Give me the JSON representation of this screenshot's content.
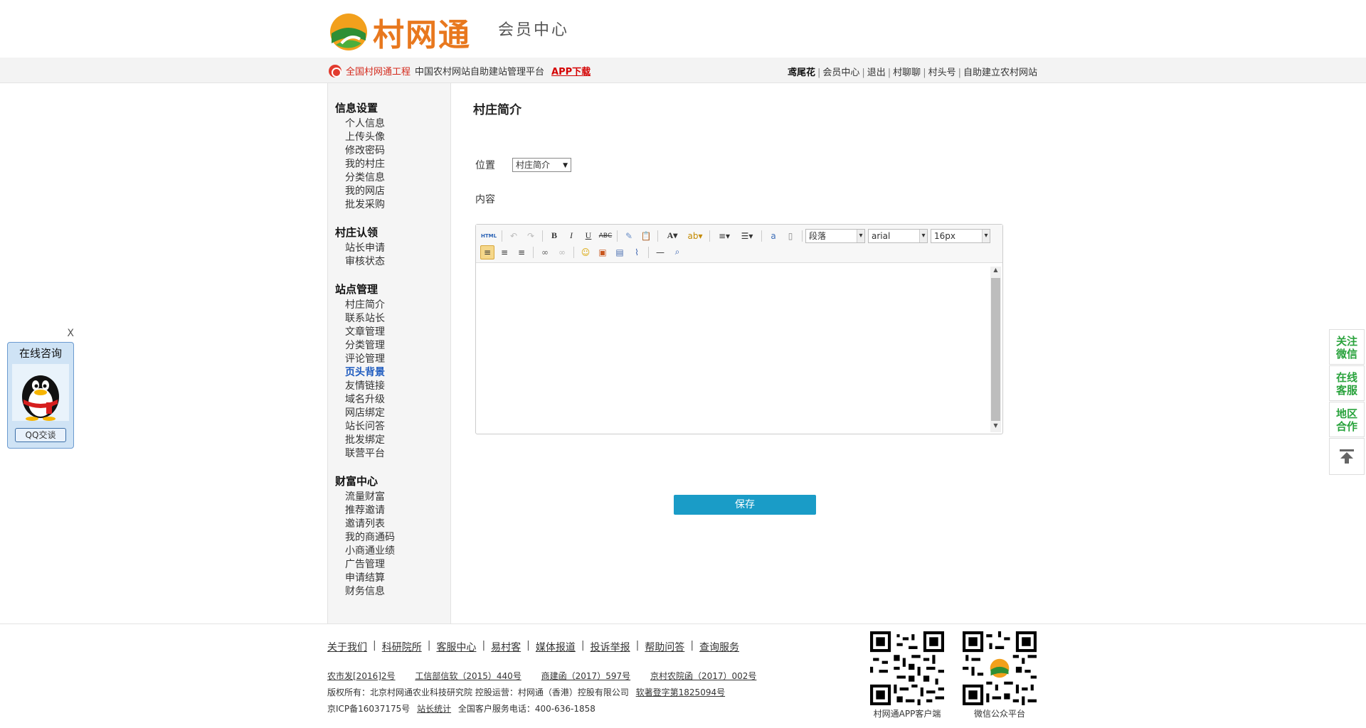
{
  "header": {
    "brand": "村网通",
    "subtitle": "会员中心"
  },
  "topbar": {
    "org_name": "全国村网通工程",
    "slogan": "中国农村网站自助建站管理平台",
    "app_download": "APP下载",
    "user": "鸢尾花",
    "links": [
      "会员中心",
      "退出",
      "村聊聊",
      "村头号",
      "自助建立农村网站"
    ]
  },
  "sidebar": {
    "groups": [
      {
        "title": "信息设置",
        "items": [
          "个人信息",
          "上传头像",
          "修改密码",
          "我的村庄",
          "分类信息",
          "我的网店",
          "批发采购"
        ]
      },
      {
        "title": "村庄认领",
        "items": [
          "站长申请",
          "审核状态"
        ]
      },
      {
        "title": "站点管理",
        "items": [
          "村庄简介",
          "联系站长",
          "文章管理",
          "分类管理",
          "评论管理",
          "页头背景",
          "友情链接",
          "域名升级",
          "网店绑定",
          "站长问答",
          "批发绑定",
          "联营平台"
        ]
      },
      {
        "title": "财富中心",
        "items": [
          "流量财富",
          "推荐邀请",
          "邀请列表",
          "我的商通码",
          "小商通业绩",
          "广告管理",
          "申请结算",
          "财务信息"
        ]
      }
    ],
    "active_item": "页头背景"
  },
  "main": {
    "title": "村庄简介",
    "position_label": "位置",
    "position_value": "村庄简介",
    "content_label": "内容",
    "save_label": "保存"
  },
  "editor": {
    "format_value": "段落",
    "font_value": "arial",
    "size_value": "16px",
    "html_label": "HTML"
  },
  "qq": {
    "title": "在线咨询",
    "button": "QQ交谈",
    "close": "X"
  },
  "right_float": {
    "wechat": "关注\n微信",
    "service": "在线\n客服",
    "region": "地区\n合作"
  },
  "footer": {
    "links": [
      "关于我们",
      "科研院所",
      "客服中心",
      "易村客",
      "媒体报道",
      "投诉举报",
      "帮助问答",
      "查询服务"
    ],
    "licenses": [
      "农市发[2016]2号",
      "工信部信软（2015）440号",
      "商建函（2017）597号",
      "京村农院函（2017）002号"
    ],
    "copyright_prefix": "版权所有：北京村网通农业科技研究院  控股运营：村网通（香港）控股有限公司",
    "copyright_link": "软著登字第1825094号",
    "icp": "京ICP备16037175号",
    "stats_link": "站长统计",
    "hotline": "全国客户服务电话：400-636-1858",
    "qr_app_label": "村网通APP客户端",
    "qr_wechat_label": "微信公众平台"
  }
}
